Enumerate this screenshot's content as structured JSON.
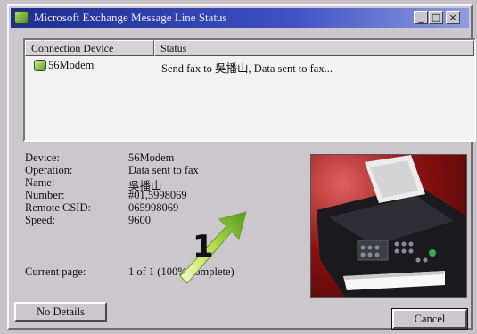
{
  "window": {
    "title": "Microsoft Exchange Message Line Status",
    "minimize_glyph": "_",
    "maximize_glyph": "□",
    "close_glyph": "×"
  },
  "list": {
    "columns": [
      "Connection Device",
      "Status"
    ],
    "rows": [
      {
        "device": "56Modem",
        "status": "Send fax to 吳播山, Data sent to fax..."
      }
    ]
  },
  "details": {
    "device_label": "Device:",
    "device_value": "56Modem",
    "operation_label": "Operation:",
    "operation_value": "Data sent to fax",
    "name_label": "Name:",
    "name_value": "吳播山",
    "number_label": "Number:",
    "number_value": "#01,5998069",
    "csid_label": "Remote CSID:",
    "csid_value": "065998069",
    "speed_label": "Speed:",
    "speed_value": "9600",
    "page_label": "Current page:",
    "page_value": "1 of 1 (100% complete)"
  },
  "callout": {
    "number": "1"
  },
  "buttons": {
    "no_details": "No Details",
    "cancel": "Cancel"
  },
  "icons": {
    "title": "fax-app-icon",
    "device": "modem-icon",
    "photo": "fax-machine-photo"
  }
}
